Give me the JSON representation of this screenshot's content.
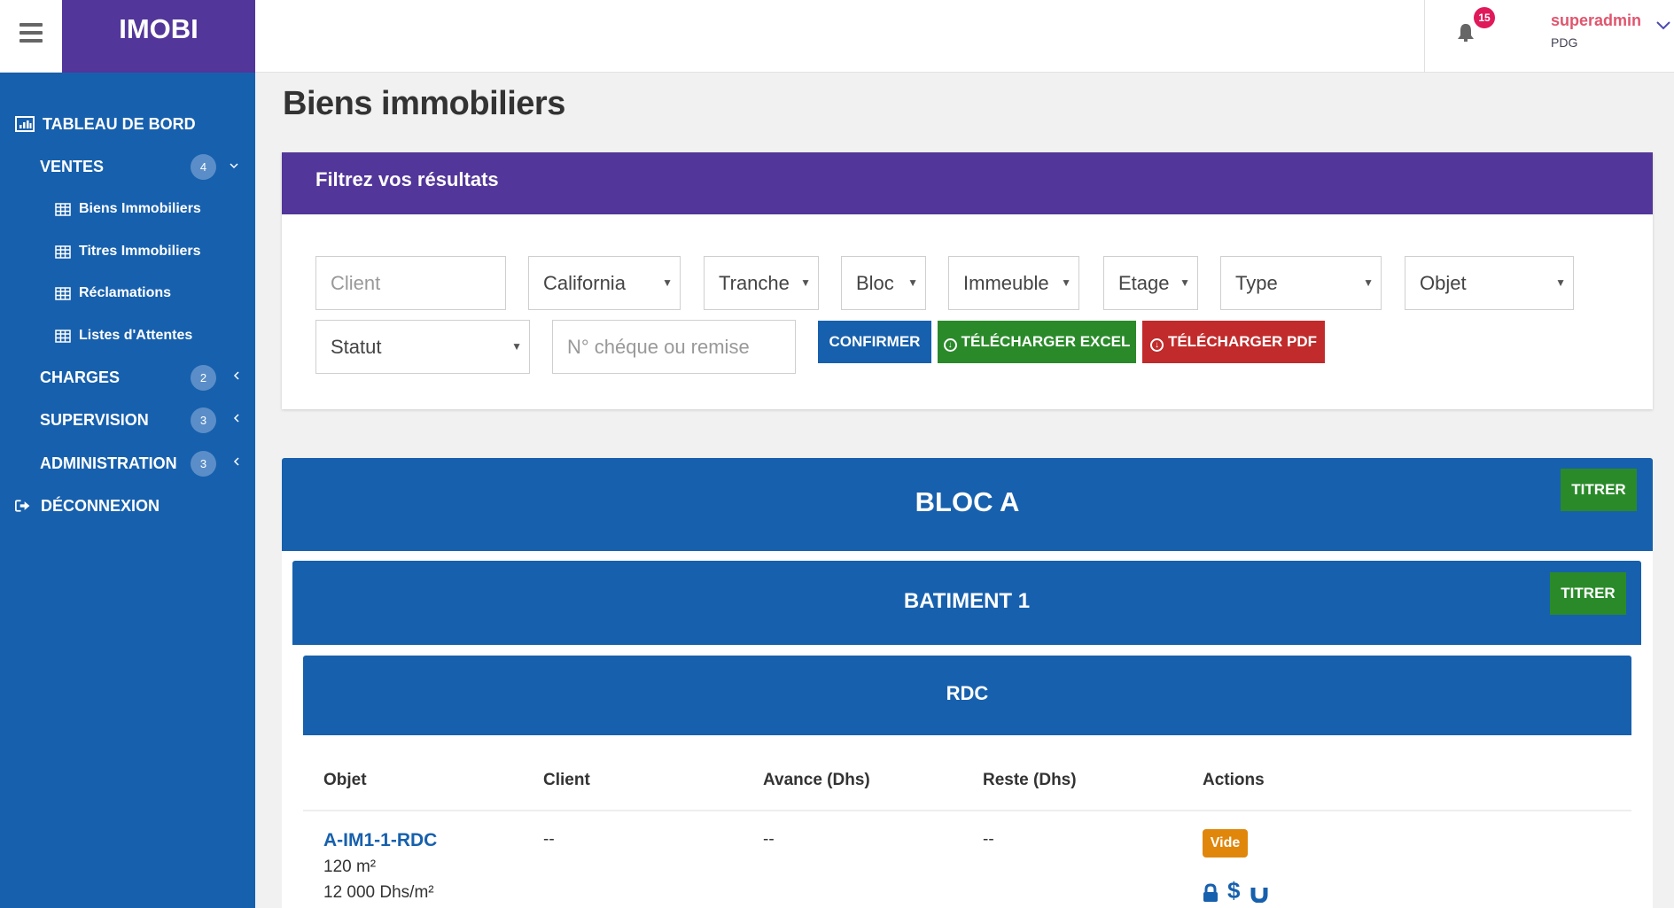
{
  "header": {
    "logo": "IMOBI",
    "notifications_count": "15",
    "user_name": "superadmin",
    "user_role": "PDG"
  },
  "sidebar": {
    "items": [
      {
        "label": "TABLEAU DE BORD",
        "icon": "bar-chart-icon"
      },
      {
        "label": "VENTES",
        "badge": "4",
        "caret": "expanded"
      },
      {
        "label": "Biens Immobiliers",
        "icon": "table-icon"
      },
      {
        "label": "Titres Immobiliers",
        "icon": "table-icon"
      },
      {
        "label": "Réclamations",
        "icon": "table-icon"
      },
      {
        "label": "Listes d'Attentes",
        "icon": "table-icon"
      },
      {
        "label": "CHARGES",
        "badge": "2",
        "caret": "collapsed"
      },
      {
        "label": "SUPERVISION",
        "badge": "3",
        "caret": "collapsed"
      },
      {
        "label": "ADMINISTRATION",
        "badge": "3",
        "caret": "collapsed"
      },
      {
        "label": "DÉCONNEXION",
        "icon": "sign-out-icon"
      }
    ]
  },
  "page": {
    "title": "Biens immobiliers"
  },
  "filters": {
    "title": "Filtrez vos résultats",
    "client_placeholder": "Client",
    "projet": "California",
    "tranche": "Tranche",
    "bloc": "Bloc",
    "immeuble": "Immeuble",
    "etage": "Etage",
    "type": "Type",
    "objet": "Objet",
    "statut": "Statut",
    "cheque_placeholder": "N° chéque ou remise",
    "confirm_label": "CONFIRMER",
    "excel_label": "TÉLÉCHARGER EXCEL",
    "pdf_label": "TÉLÉCHARGER PDF"
  },
  "bloc": {
    "title": "BLOC A",
    "titrer_label": "TITRER",
    "batiment": {
      "title": "BATIMENT 1",
      "titrer_label": "TITRER",
      "etage": {
        "title": "RDC",
        "columns": [
          "Objet",
          "Client",
          "Avance (Dhs)",
          "Reste (Dhs)",
          "Actions"
        ],
        "rows": [
          {
            "objet": "A-IM1-1-RDC",
            "surface": "120 m²",
            "prix_m2": "12 000 Dhs/m²",
            "client": "--",
            "avance": "--",
            "reste": "--",
            "status": "Vide",
            "status_color": "#e0860b"
          }
        ]
      }
    }
  },
  "colors": {
    "primary": "#1760ad",
    "brand_purple": "#523699",
    "success": "#2a8a2a",
    "danger": "#c12b2b",
    "warning": "#e0860b",
    "badge_red": "#e0195a"
  }
}
